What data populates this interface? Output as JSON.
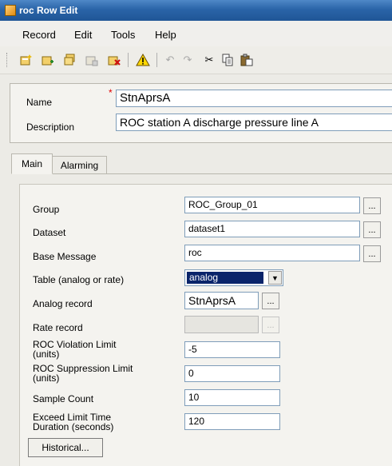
{
  "window": {
    "title": "roc Row Edit"
  },
  "menu": [
    "Record",
    "Edit",
    "Tools",
    "Help"
  ],
  "toolbar": {
    "icons": [
      "new-record-icon",
      "add-record-icon",
      "copy-record-icon",
      "paste-record-icon",
      "delete-record-icon",
      "warning-icon",
      "undo-icon",
      "redo-icon",
      "cut-icon",
      "copy-icon",
      "paste-icon"
    ]
  },
  "header": {
    "name_label": "Name",
    "name_value": "StnAprsA",
    "required_marker": "*",
    "description_label": "Description",
    "description_value": "ROC station A discharge pressure line A"
  },
  "tabs": [
    "Main",
    "Alarming"
  ],
  "main": {
    "group_label": "Group",
    "group_value": "ROC_Group_01",
    "dataset_label": "Dataset",
    "dataset_value": "dataset1",
    "base_message_label": "Base Message",
    "base_message_value": "roc",
    "table_label": "Table (analog or rate)",
    "table_value": "analog",
    "analog_record_label": "Analog record",
    "analog_record_value": "StnAprsA",
    "rate_record_label": "Rate record",
    "rate_record_value": "",
    "roc_violation_label_1": "ROC Violation Limit",
    "roc_violation_label_2": "(units)",
    "roc_violation_value": "-5",
    "roc_suppression_label_1": "ROC Suppression Limit",
    "roc_suppression_label_2": "(units)",
    "roc_suppression_value": "0",
    "sample_count_label": "Sample Count",
    "sample_count_value": "10",
    "exceed_label_1": "Exceed Limit Time",
    "exceed_label_2": "Duration (seconds)",
    "exceed_value": "120",
    "browse_label": "...",
    "historical_button": "Historical..."
  },
  "colors": {
    "titlebar": "#2a64a8",
    "selection": "#0a246a",
    "required": "#e10000"
  }
}
